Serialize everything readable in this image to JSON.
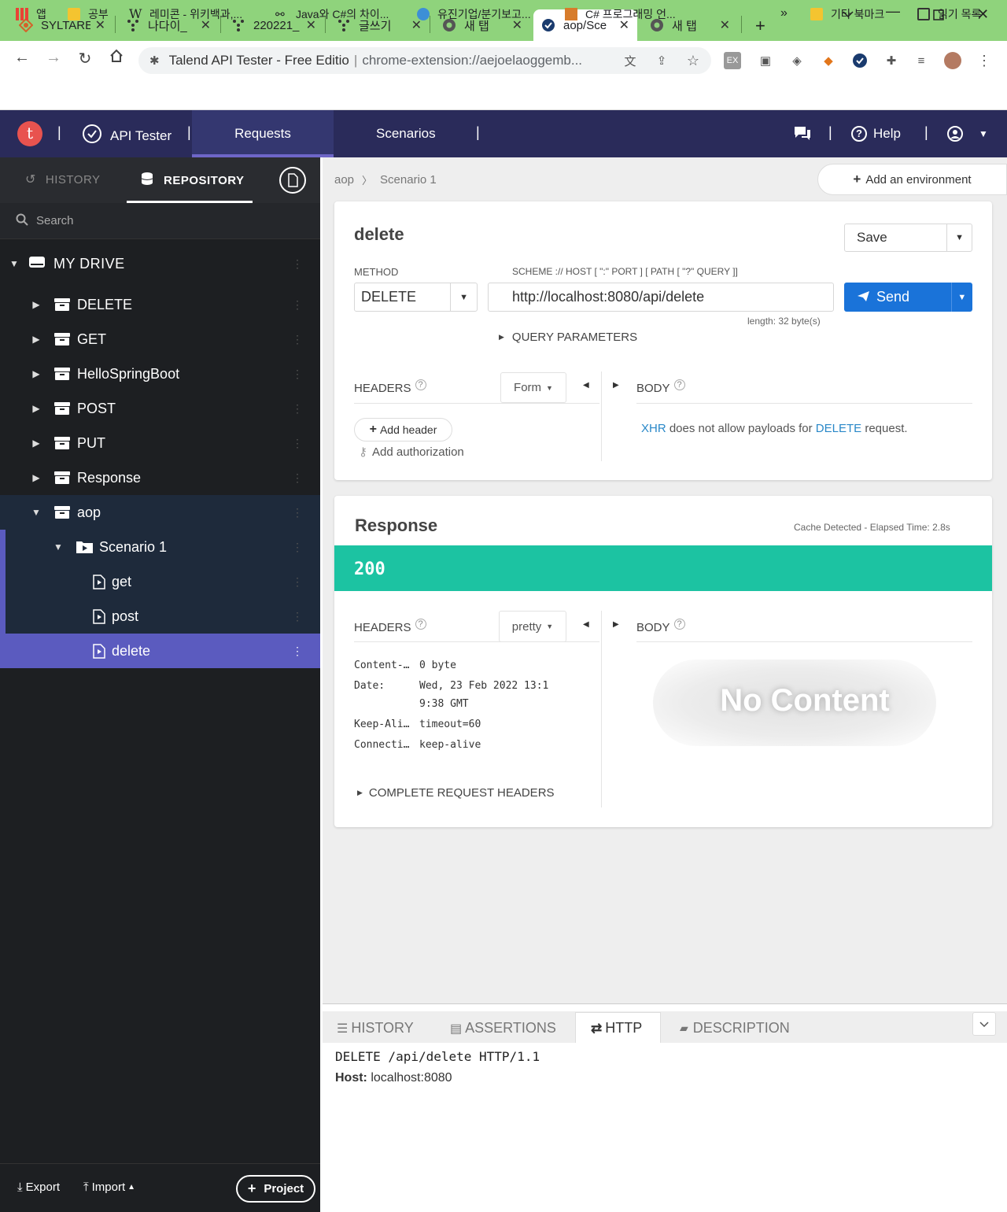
{
  "browser": {
    "tabs": [
      {
        "title": "SYLTARE",
        "icon": "sylt-icon"
      },
      {
        "title": "나다이_",
        "icon": "dots-icon"
      },
      {
        "title": "220221_",
        "icon": "dots-icon"
      },
      {
        "title": "글쓰기",
        "icon": "dots-icon"
      },
      {
        "title": "새 탭",
        "icon": "chrome-icon"
      },
      {
        "title": "aop/Sce",
        "icon": "check-icon"
      },
      {
        "title": "새 탭",
        "icon": "chrome-icon"
      }
    ],
    "omnibox": {
      "site_name": "Talend API Tester - Free Editio",
      "url": "chrome-extension://aejoelaoggemb..."
    },
    "bookmarks": [
      "앱",
      "공부",
      "레미콘 - 위키백과,...",
      "Java와 C#의 차이...",
      "유진기업/분기보고...",
      "C# 프로그래밍 언..."
    ],
    "bookmarks_more": "»",
    "bookmarks_right": [
      "기타 북마크",
      "읽기 목록"
    ]
  },
  "app": {
    "logo_letter": "t",
    "sep": "|",
    "product": "API Tester",
    "nav": {
      "requests": "Requests",
      "scenarios": "Scenarios"
    },
    "help": "Help"
  },
  "sidebar": {
    "tabs": {
      "history": "HISTORY",
      "repository": "REPOSITORY"
    },
    "search_placeholder": "Search",
    "drive": "MY DRIVE",
    "items": [
      {
        "label": "DELETE"
      },
      {
        "label": "GET"
      },
      {
        "label": "HelloSpringBoot"
      },
      {
        "label": "POST"
      },
      {
        "label": "PUT"
      },
      {
        "label": "Response"
      },
      {
        "label": "aop"
      },
      {
        "label": "Scenario 1"
      },
      {
        "label": "get"
      },
      {
        "label": "post"
      },
      {
        "label": "delete"
      }
    ],
    "footer": {
      "export": "Export",
      "import": "Import",
      "project": "Project"
    }
  },
  "main": {
    "breadcrumb": [
      "aop",
      "Scenario 1"
    ],
    "add_env": "Add an environment",
    "request": {
      "name": "delete",
      "save": "Save",
      "method_label": "METHOD",
      "method": "DELETE",
      "url_label": "SCHEME :// HOST [ \":\" PORT ] [ PATH [ \"?\" QUERY ]]",
      "url": "http://localhost:8080/api/delete",
      "length": "length: 32 byte(s)",
      "send": "Send",
      "query_params": "QUERY PARAMETERS",
      "headers": "HEADERS",
      "form": "Form",
      "body": "BODY",
      "add_header": "Add header",
      "add_auth": "Add authorization",
      "body_msg": {
        "xhr": "XHR",
        "mid": "does not allow payloads for",
        "method": "DELETE",
        "end": "request."
      }
    },
    "response": {
      "title": "Response",
      "meta": "Cache Detected - Elapsed Time: 2.8s",
      "status": "200",
      "status_color": "#1cc3a2",
      "headers": "HEADERS",
      "pretty": "pretty",
      "body": "BODY",
      "header_rows": [
        {
          "k": "Content-…",
          "v": "0 byte"
        },
        {
          "k": "Date:",
          "v": "Wed, 23 Feb 2022 13:1"
        },
        {
          "k": "",
          "v": "9:38 GMT"
        },
        {
          "k": "Keep-Ali…",
          "v": "timeout=60"
        },
        {
          "k": "Connecti…",
          "v": "keep-alive"
        }
      ],
      "complete_headers": "COMPLETE REQUEST HEADERS",
      "no_content": "No Content"
    }
  },
  "bottom": {
    "tabs": {
      "history": "HISTORY",
      "assertions": "ASSERTIONS",
      "http": "HTTP",
      "description": "DESCRIPTION"
    },
    "request_line": "DELETE /api/delete HTTP/1.1",
    "host_key": "Host:",
    "host_val": "localhost:8080"
  },
  "colors": {
    "accent": "#6e66c7",
    "header": "#2a2b5a",
    "send": "#1a73d9",
    "selected": "#5b5bbf",
    "link": "#2a88c8"
  }
}
